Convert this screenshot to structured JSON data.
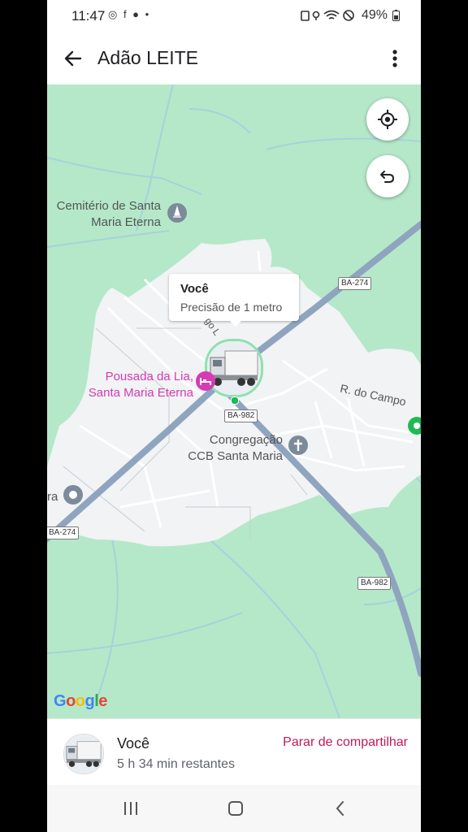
{
  "status_bar": {
    "time": "11:47",
    "left_icons": "◎ f ● •",
    "battery": "49%"
  },
  "app_bar": {
    "title": "Adão LEITE"
  },
  "map": {
    "labels": {
      "cemetery_line1": "Cemitério de Santa",
      "cemetery_line2": "Maria Eterna",
      "pousada_line1": "Pousada da Lia,",
      "pousada_line2": "Santa Maria Eterna",
      "church_line1": "Congregação",
      "church_line2": "CCB Santa Maria",
      "street_campo": "R. do Campo",
      "street_partial": "go L",
      "left_partial": "ra"
    },
    "road_shields": {
      "ba274_top": "BA-274",
      "ba982_center": "BA-982",
      "ba274_left": "BA-274",
      "ba982_bottom": "BA-982"
    },
    "callout": {
      "title": "Você",
      "subtitle": "Precisão de 1 metro"
    },
    "google_logo": [
      "G",
      "o",
      "o",
      "g",
      "l",
      "e"
    ],
    "colors": {
      "park": "#b4e8c9",
      "town": "#f1f3f4",
      "highway": "#8fa4bf",
      "pink_poi": "#d63ab5",
      "accent_pink": "#c2185b"
    }
  },
  "bottom_sheet": {
    "name": "Você",
    "time_remaining": "5 h 34 min restantes",
    "stop_sharing_label": "Parar de compartilhar"
  }
}
